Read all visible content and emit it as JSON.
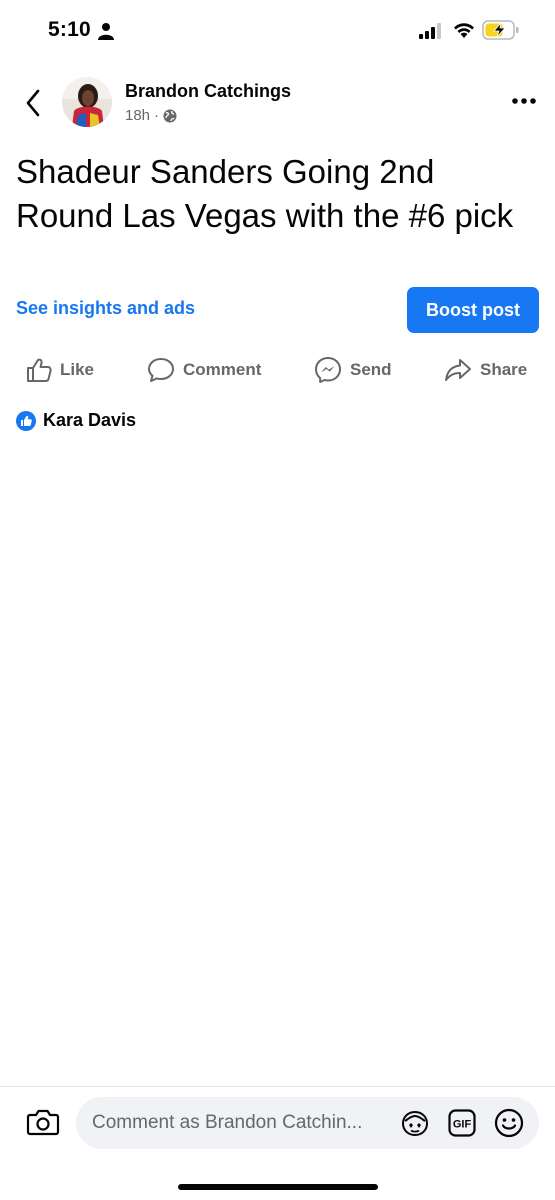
{
  "status_bar": {
    "time": "5:10",
    "icons": [
      "person-icon",
      "cellular-signal-icon",
      "wifi-icon",
      "battery-charging-icon"
    ]
  },
  "header": {
    "author_name": "Brandon Catchings",
    "timestamp": "18h",
    "separator": "·",
    "privacy_icon": "globe-icon",
    "back_icon": "chevron-left-icon",
    "more_icon": "more-dots-icon"
  },
  "post": {
    "text": "Shadeur Sanders Going 2nd Round Las Vegas with the #6 pick"
  },
  "insights": {
    "link_label": "See insights and ads",
    "boost_label": "Boost post"
  },
  "actions": {
    "like_label": "Like",
    "comment_label": "Comment",
    "send_label": "Send",
    "share_label": "Share"
  },
  "reactions": {
    "names": "Kara Davis",
    "reaction_icon": "like-reaction-icon"
  },
  "composer": {
    "placeholder": "Comment as Brandon Catchin...",
    "gif_label": "GIF"
  },
  "colors": {
    "accent": "#1877f2",
    "secondary_text": "#65676b",
    "input_bg": "#f0f2f5",
    "battery_charge": "#f7d51d"
  }
}
